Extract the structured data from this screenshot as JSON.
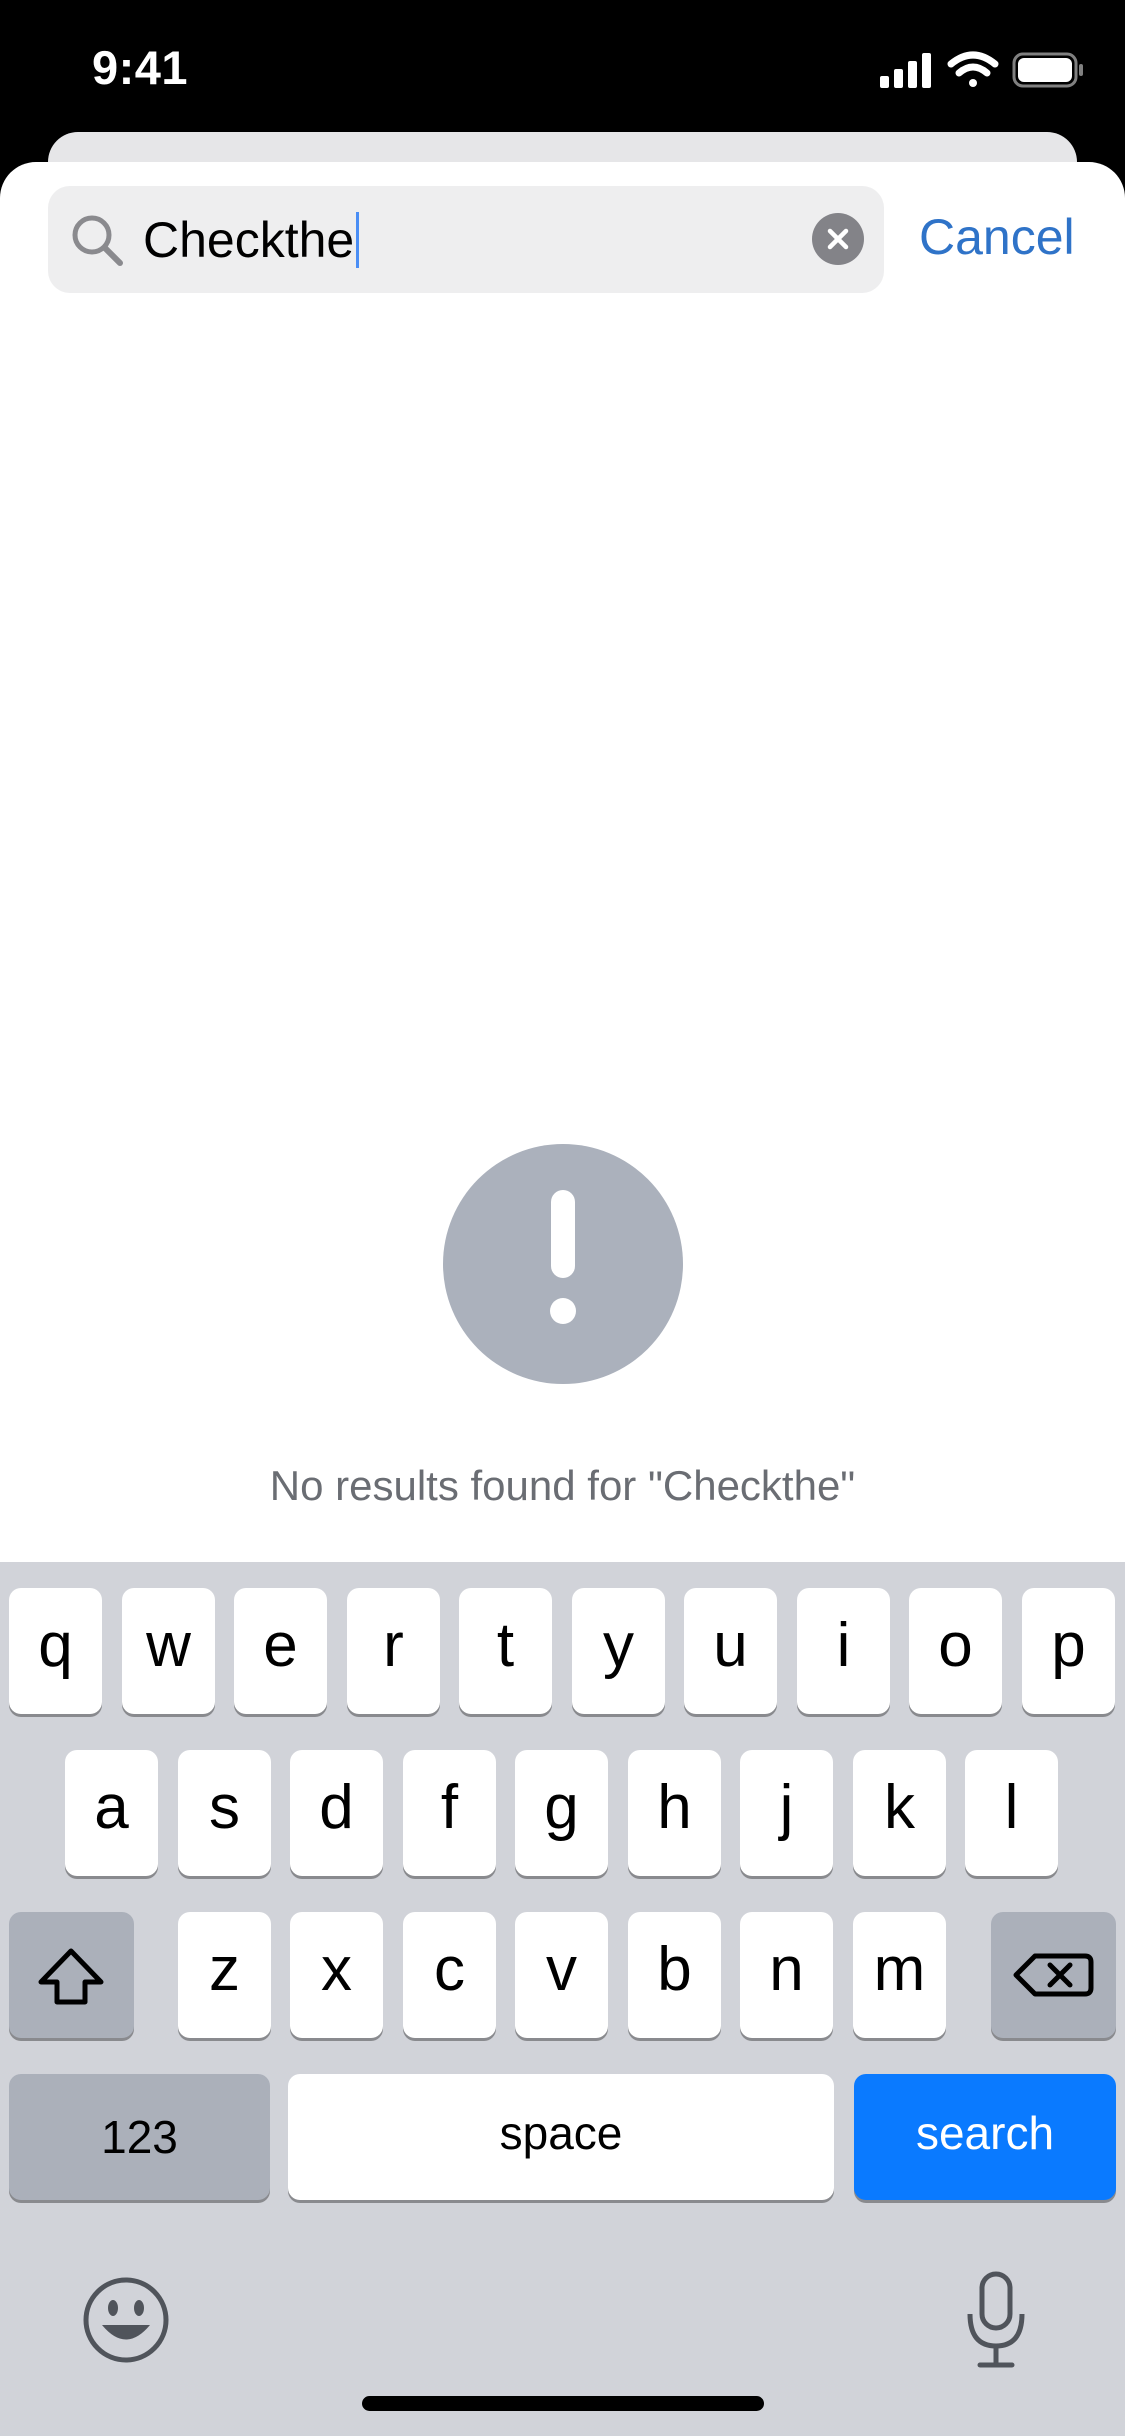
{
  "status_bar": {
    "time": "9:41",
    "icons": [
      "cellular-signal-icon",
      "wifi-icon",
      "battery-icon"
    ]
  },
  "search": {
    "value": "Checkthe",
    "icon": "search-icon",
    "clear_icon": "clear-icon",
    "cancel_label": "Cancel"
  },
  "empty_state": {
    "icon": "exclamation-icon",
    "message": "No results found for \"Checkthe\""
  },
  "keyboard": {
    "row1": [
      "q",
      "w",
      "e",
      "r",
      "t",
      "y",
      "u",
      "i",
      "o",
      "p"
    ],
    "row2": [
      "a",
      "s",
      "d",
      "f",
      "g",
      "h",
      "j",
      "k",
      "l"
    ],
    "row3": [
      "z",
      "x",
      "c",
      "v",
      "b",
      "n",
      "m"
    ],
    "numbers_label": "123",
    "space_label": "space",
    "search_label": "search"
  },
  "colors": {
    "accent": "#2f73c8",
    "search_key": "#0a7aff",
    "keyboard_bg": "#d1d3d9",
    "alert_icon_bg": "#abb1bc"
  }
}
